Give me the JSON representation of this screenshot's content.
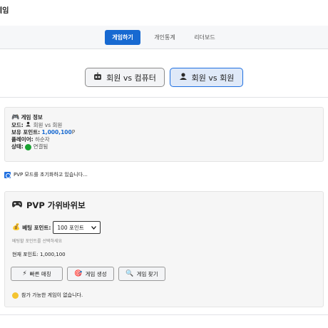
{
  "app": {
    "title": "게임"
  },
  "nav": {
    "tabs": [
      {
        "label": "게임하기",
        "active": true
      },
      {
        "label": "개인통계",
        "active": false
      },
      {
        "label": "리더보드",
        "active": false
      }
    ]
  },
  "modes": {
    "cpu_label": "회원 vs 컴퓨터",
    "pvp_label": "회원 vs 회원",
    "selected": "pvp"
  },
  "info": {
    "heading": "게임 정보",
    "mode_label": "모드:",
    "mode_value": "회원 vs 회원",
    "points_label": "보유 포인트:",
    "points_value": "1,000,100",
    "points_unit": "P",
    "player_label": "플레이어:",
    "player_value": "하순자",
    "status_label": "상태:",
    "status_value": "연결됨"
  },
  "status_message": "PVP 모드를 초기화하고 있습니다...",
  "game": {
    "title": "PVP 가위바위보",
    "bet_label": "베팅 포인트:",
    "bet_selected": "100 포인트",
    "bet_hint": "베팅할 포인트를 선택하세요",
    "current_points": "현재 포인트: 1,000,100",
    "quick_match_label": "빠른 매칭",
    "create_game_label": "게임 생성",
    "find_game_label": "게임 찾기",
    "empty_message": "참가 가능한 게임이 없습니다."
  },
  "colors": {
    "accent": "#1769d1",
    "connected": "#1aa332"
  }
}
